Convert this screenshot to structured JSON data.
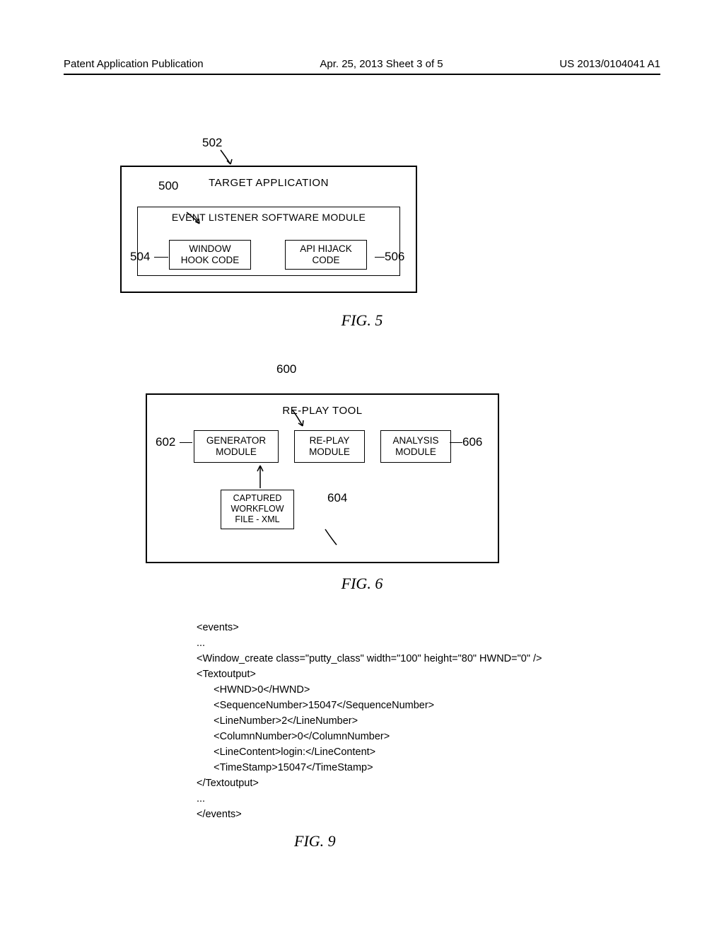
{
  "header": {
    "left": "Patent Application Publication",
    "mid": "Apr. 25, 2013  Sheet 3 of 5",
    "right": "US 2013/0104041 A1"
  },
  "fig5": {
    "title": "FIG. 5",
    "outer_label": "TARGET APPLICATION",
    "inner_label": "EVENT LISTENER SOFTWARE MODULE",
    "box_left_l1": "WINDOW",
    "box_left_l2": "HOOK CODE",
    "box_right_l1": "API HIJACK",
    "box_right_l2": "CODE",
    "ref_502": "502",
    "ref_500": "500",
    "ref_504": "504",
    "ref_506": "506"
  },
  "fig6": {
    "title": "FIG. 6",
    "outer_label": "RE-PLAY TOOL",
    "box_g_l1": "GENERATOR",
    "box_g_l2": "MODULE",
    "box_r_l1": "RE-PLAY",
    "box_r_l2": "MODULE",
    "box_a_l1": "ANALYSIS",
    "box_a_l2": "MODULE",
    "xml_l1": "CAPTURED",
    "xml_l2": "WORKFLOW",
    "xml_l3": "FILE - XML",
    "ref_600": "600",
    "ref_602": "602",
    "ref_604": "604",
    "ref_606": "606"
  },
  "fig9": {
    "title": "FIG. 9",
    "lines": [
      "<events>",
      "...",
      "<Window_create class=\"putty_class\" width=\"100\" height=\"80\" HWND=\"0\" />",
      "<Textoutput>",
      "      <HWND>0</HWND>",
      "      <SequenceNumber>15047</SequenceNumber>",
      "      <LineNumber>2</LineNumber>",
      "      <ColumnNumber>0</ColumnNumber>",
      "      <LineContent>login:</LineContent>",
      "      <TimeStamp>15047</TimeStamp>",
      "</Textoutput>",
      "...",
      "</events>"
    ]
  }
}
